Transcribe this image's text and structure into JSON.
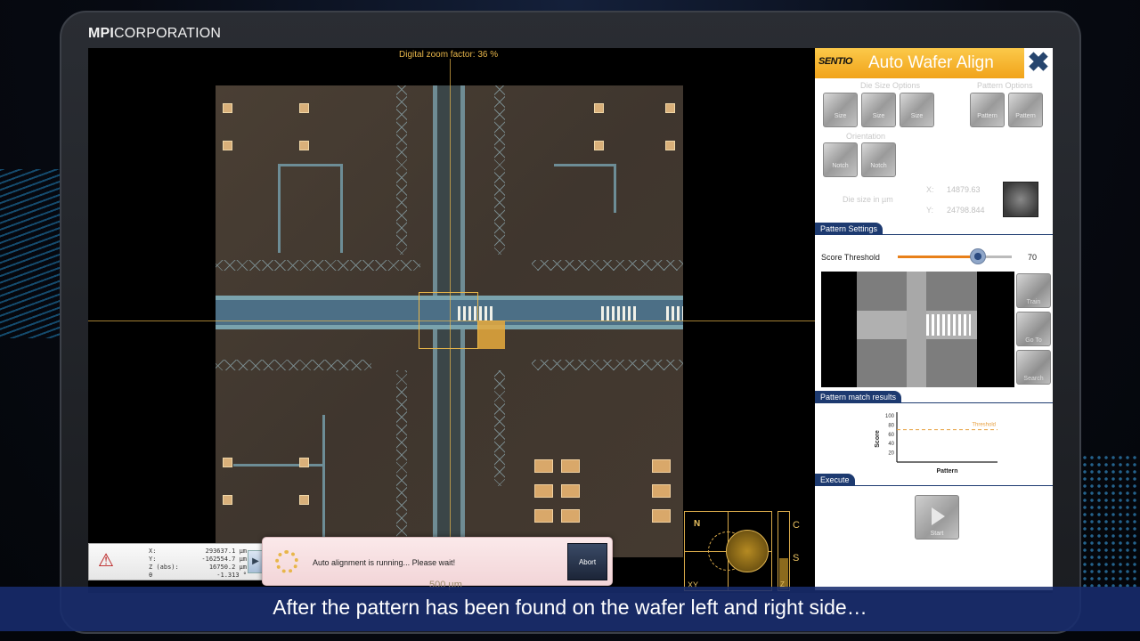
{
  "brand": {
    "bold": "MPI",
    "rest": "CORPORATION"
  },
  "camera": {
    "zoom_label": "Digital zoom factor: 36 %",
    "scale_text": "500 µm"
  },
  "minimap": {
    "north": "N",
    "xy": "XY"
  },
  "z_indicator": {
    "top": "C",
    "mid": "S",
    "bottom": "Z",
    "level_fraction": 0.4
  },
  "coords": {
    "rows": [
      {
        "key": "X:",
        "value": "293637.1 µm"
      },
      {
        "key": "Y:",
        "value": "-162554.7 µm"
      },
      {
        "key": "Z (abs):",
        "value": "16750.2 µm"
      },
      {
        "key": "θ",
        "value": "-1.313 °"
      }
    ]
  },
  "dialog": {
    "message": "Auto alignment is running... Please wait!",
    "abort": "Abort"
  },
  "panel": {
    "logo": "SENTIO",
    "title": "Auto Wafer Align",
    "die_size_options_label": "Die Size Options",
    "pattern_options_label": "Pattern Options",
    "orientation_label": "Orientation",
    "die_btns": [
      "Size",
      "Size",
      "Size"
    ],
    "pattern_btns": [
      "Pattern",
      "Pattern"
    ],
    "orient_btns": [
      "Notch",
      "Notch"
    ],
    "die_size_label": "Die size in µm",
    "die_x_label": "X:",
    "die_x_val": "14879.63",
    "die_y_label": "Y:",
    "die_y_val": "24798.844",
    "pattern_settings": "Pattern Settings",
    "score_threshold_label": "Score Threshold",
    "score_threshold_value": "70",
    "score_threshold_max": 100,
    "side_btns": [
      "Train",
      "Go To",
      "Search"
    ],
    "pattern_match_results": "Pattern match results",
    "execute": "Execute",
    "start": "Start"
  },
  "chart_data": {
    "type": "line",
    "title": "",
    "xlabel": "Pattern",
    "ylabel": "Score",
    "y_ticks": [
      "100",
      "80",
      "60",
      "40",
      "20"
    ],
    "ylim": [
      0,
      100
    ],
    "threshold_label": "Threshold",
    "threshold_value": 70,
    "series": []
  },
  "subtitle": "After the pattern has been found on the wafer left and right side…",
  "colors": {
    "accent": "#f1a31a",
    "nav": "#1d3a70",
    "crosshair": "#e8b64a"
  }
}
